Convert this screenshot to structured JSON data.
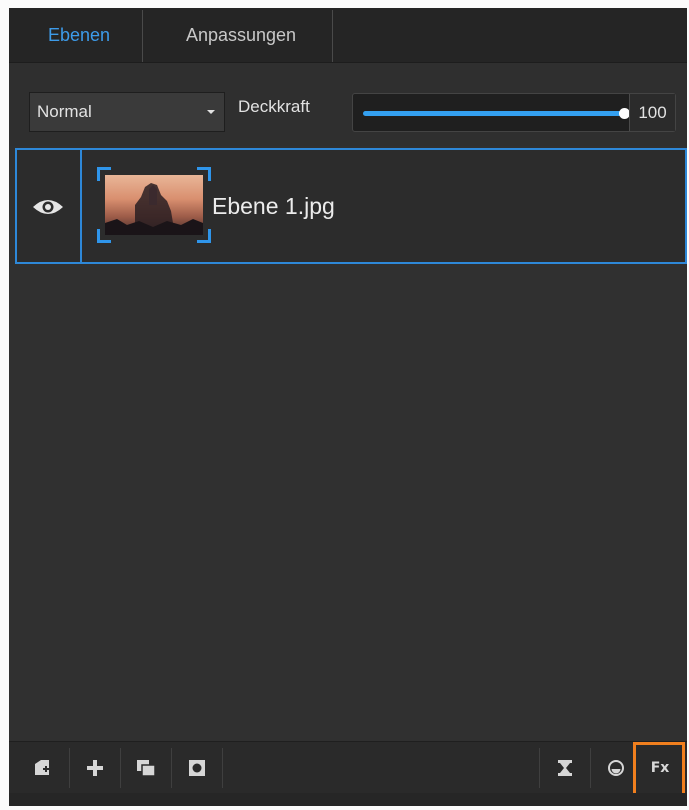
{
  "tabs": [
    {
      "label": "Ebenen",
      "active": true
    },
    {
      "label": "Anpassungen",
      "active": false
    }
  ],
  "options": {
    "blend_mode": "Normal",
    "opacity_label": "Deckkraft",
    "opacity_value": "100",
    "opacity_fraction": 1.0
  },
  "layers": [
    {
      "name": "Ebene 1.jpg",
      "visible": true,
      "selected": true
    }
  ],
  "toolbar": {
    "left_tools": [
      "new-layer-icon",
      "add-icon",
      "duplicate-layer-icon",
      "mask-icon"
    ],
    "right_tools": [
      "merge-icon",
      "adjust-icon",
      "fx-icon"
    ],
    "fx_label": "Fx"
  },
  "colors": {
    "accent": "#3d9be9",
    "highlight": "#f07f1e",
    "panel": "#2f2f2f"
  }
}
